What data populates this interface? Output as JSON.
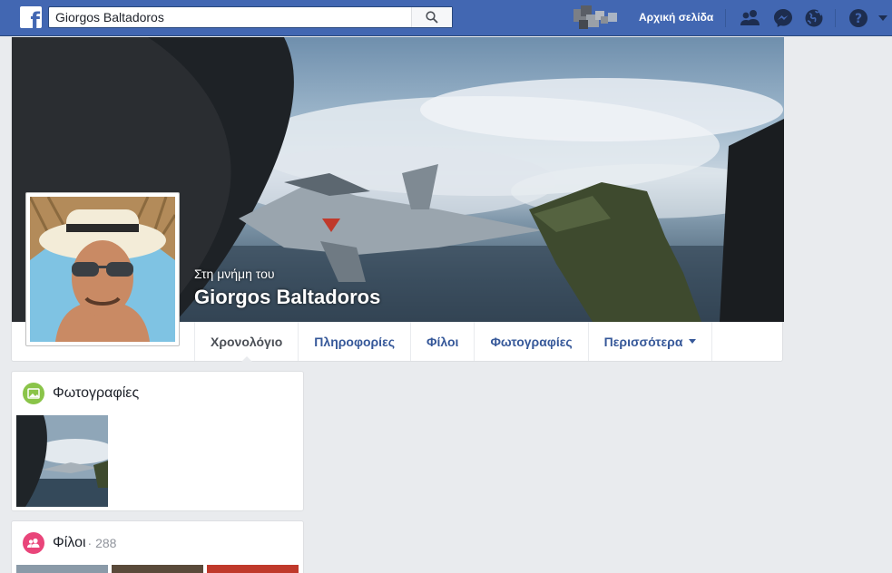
{
  "search": {
    "value": "Giorgos Baltadoros"
  },
  "nav": {
    "home_label": "Αρχική σελίδα"
  },
  "icons": {
    "logo": "facebook-logo",
    "search": "search-icon",
    "friends": "friend-requests-icon",
    "messenger": "messenger-icon",
    "notifications": "globe-icon",
    "help": "help-icon",
    "menu": "caret-down-icon"
  },
  "profile": {
    "memorial_label": "Στη μνήμη του",
    "name": "Giorgos Baltadoros"
  },
  "tabs": [
    {
      "label": "Χρονολόγιο",
      "active": true
    },
    {
      "label": "Πληροφορίες"
    },
    {
      "label": "Φίλοι"
    },
    {
      "label": "Φωτογραφίες"
    },
    {
      "label": "Περισσότερα"
    }
  ],
  "photos_card": {
    "title": "Φωτογραφίες"
  },
  "friends_card": {
    "title": "Φίλοι",
    "count": " · 288"
  },
  "colors": {
    "brand": "#4267b2",
    "photos_icon": "#8ac449",
    "friends_icon": "#e9457a"
  }
}
